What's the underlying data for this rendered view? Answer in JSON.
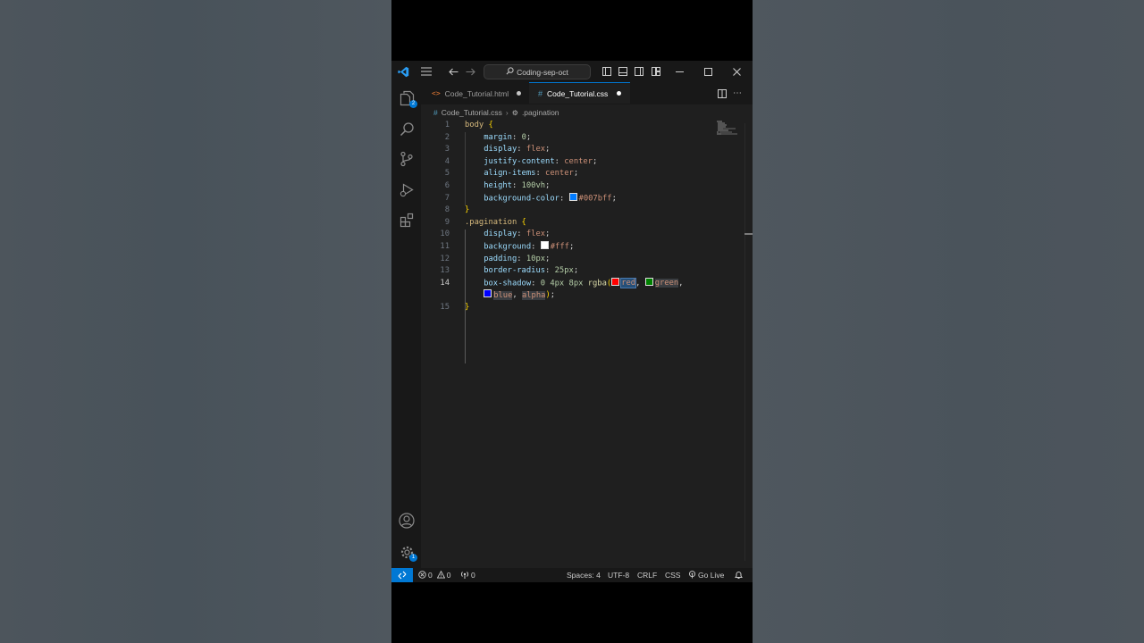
{
  "window": {
    "search_text": "Coding-sep-oct",
    "search_icon": "search-icon"
  },
  "activity_bar": {
    "explorer_badge": "2",
    "settings_badge": "1"
  },
  "tabs": [
    {
      "label": "Code_Tutorial.html",
      "icon": "html-brackets-icon",
      "modified": true
    },
    {
      "label": "Code_Tutorial.css",
      "icon": "hash-icon",
      "modified": true,
      "active": true
    }
  ],
  "breadcrumb": {
    "file": "Code_Tutorial.css",
    "symbol": ".pagination"
  },
  "editor": {
    "current_line": "14",
    "line_numbers": [
      "1",
      "2",
      "3",
      "4",
      "5",
      "6",
      "7",
      "8",
      "9",
      "10",
      "11",
      "12",
      "13",
      "14",
      "",
      "15"
    ],
    "swatch_colors": {
      "bg_007bff": "#007bff",
      "fff": "#ffffff",
      "red": "#ff0000",
      "green": "#008000",
      "blue": "#0000ff"
    },
    "lines": {
      "l1_sel": "body",
      "l1_brace": " {",
      "l2_prop": "margin",
      "l2_val": "0",
      "l3_prop": "display",
      "l3_val": "flex",
      "l4_prop": "justify-content",
      "l4_val": "center",
      "l5_prop": "align-items",
      "l5_val": "center",
      "l6_prop": "height",
      "l6_val": "100vh",
      "l7_prop": "background-color",
      "l7_val": "#007bff",
      "l8_brace": "}",
      "l9_sel": ".pagination",
      "l9_brace": " {",
      "l10_prop": "display",
      "l10_val": "flex",
      "l11_prop": "background",
      "l11_val": "#fff",
      "l12_prop": "padding",
      "l12_val": "10px",
      "l13_prop": "border-radius",
      "l13_val": "25px",
      "l14_prop": "box-shadow",
      "l14_pre": "0 4px 8px",
      "l14_fn": "rgba",
      "l14_a1": "red",
      "l14_a2": "green",
      "l14_a3": "blue",
      "l14_a4": "alpha",
      "l15_brace": "}"
    }
  },
  "status_bar": {
    "errors": "0",
    "warnings": "0",
    "ports": "0",
    "spaces": "Spaces: 4",
    "encoding": "UTF-8",
    "eol": "CRLF",
    "language": "CSS",
    "go_live": "Go Live"
  },
  "colors": {
    "accent": "#0078d4",
    "editor_bg": "#1f1f1f",
    "chrome_bg": "#181818"
  }
}
